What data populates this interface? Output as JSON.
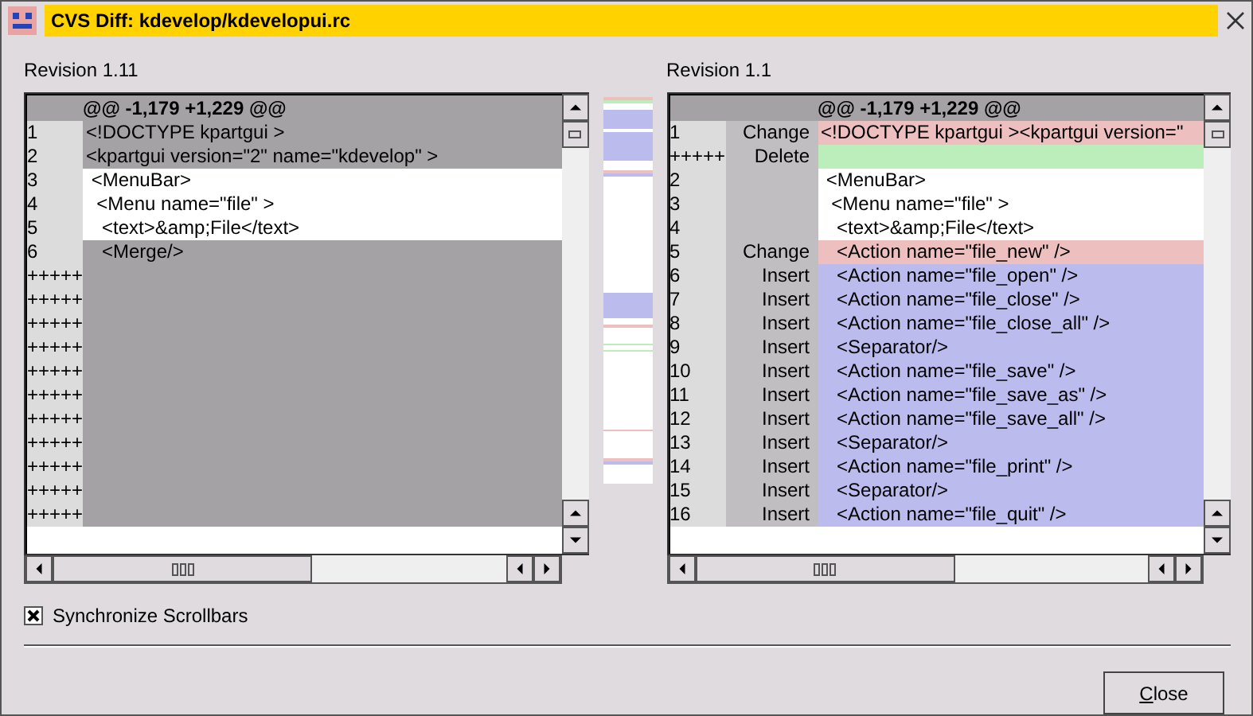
{
  "window": {
    "title": "CVS Diff: kdevelop/kdevelopui.rc"
  },
  "panels": [
    {
      "revision": "Revision 1.11",
      "hunk": "@@ -1,179 +1,229 @@",
      "show_type": false,
      "rows": [
        {
          "line": "1",
          "kind": "changed",
          "text": "<!DOCTYPE kpartgui >"
        },
        {
          "line": "2",
          "kind": "changed",
          "text": "<kpartgui version=\"2\" name=\"kdevelop\" >"
        },
        {
          "line": "3",
          "kind": "unchanged",
          "text": " <MenuBar>"
        },
        {
          "line": "4",
          "kind": "unchanged",
          "text": "  <Menu name=\"file\" >"
        },
        {
          "line": "5",
          "kind": "unchanged",
          "text": "   <text>&amp;File</text>"
        },
        {
          "line": "6",
          "kind": "changed",
          "text": "   <Merge/>"
        },
        {
          "line": "+++++",
          "kind": "filler"
        },
        {
          "line": "+++++",
          "kind": "filler"
        },
        {
          "line": "+++++",
          "kind": "filler"
        },
        {
          "line": "+++++",
          "kind": "filler"
        },
        {
          "line": "+++++",
          "kind": "filler"
        },
        {
          "line": "+++++",
          "kind": "filler"
        },
        {
          "line": "+++++",
          "kind": "filler"
        },
        {
          "line": "+++++",
          "kind": "filler"
        },
        {
          "line": "+++++",
          "kind": "filler"
        },
        {
          "line": "+++++",
          "kind": "filler"
        },
        {
          "line": "+++++",
          "kind": "filler"
        }
      ]
    },
    {
      "revision": "Revision 1.1",
      "hunk": "@@ -1,179 +1,229 @@",
      "show_type": true,
      "rows": [
        {
          "line": "1",
          "type": "Change",
          "kind": "change",
          "text": "<!DOCTYPE kpartgui ><kpartgui version=\""
        },
        {
          "line": "+++++",
          "type": "Delete",
          "kind": "delete"
        },
        {
          "line": "2",
          "kind": "unchanged",
          "text": " <MenuBar>"
        },
        {
          "line": "3",
          "kind": "unchanged",
          "text": "  <Menu name=\"file\" >"
        },
        {
          "line": "4",
          "kind": "unchanged",
          "text": "   <text>&amp;File</text>"
        },
        {
          "line": "5",
          "type": "Change",
          "kind": "change",
          "text": "   <Action name=\"file_new\" />"
        },
        {
          "line": "6",
          "type": "Insert",
          "kind": "insert",
          "text": "   <Action name=\"file_open\" />"
        },
        {
          "line": "7",
          "type": "Insert",
          "kind": "insert",
          "text": "   <Action name=\"file_close\" />"
        },
        {
          "line": "8",
          "type": "Insert",
          "kind": "insert",
          "text": "   <Action name=\"file_close_all\" />"
        },
        {
          "line": "9",
          "type": "Insert",
          "kind": "insert",
          "text": "   <Separator/>"
        },
        {
          "line": "10",
          "type": "Insert",
          "kind": "insert",
          "text": "   <Action name=\"file_save\" />"
        },
        {
          "line": "11",
          "type": "Insert",
          "kind": "insert",
          "text": "   <Action name=\"file_save_as\" />"
        },
        {
          "line": "12",
          "type": "Insert",
          "kind": "insert",
          "text": "   <Action name=\"file_save_all\" />"
        },
        {
          "line": "13",
          "type": "Insert",
          "kind": "insert",
          "text": "   <Separator/>"
        },
        {
          "line": "14",
          "type": "Insert",
          "kind": "insert",
          "text": "   <Action name=\"file_print\" />"
        },
        {
          "line": "15",
          "type": "Insert",
          "kind": "insert",
          "text": "   <Separator/>"
        },
        {
          "line": "16",
          "type": "Insert",
          "kind": "insert",
          "text": "   <Action name=\"file_quit\" />"
        }
      ]
    }
  ],
  "sync": {
    "label": "Synchronize Scrollbars",
    "checked": true
  },
  "close_button": {
    "label_parts": [
      {
        "text": "C",
        "underlined": true
      },
      {
        "text": "lose",
        "underlined": false
      }
    ]
  }
}
